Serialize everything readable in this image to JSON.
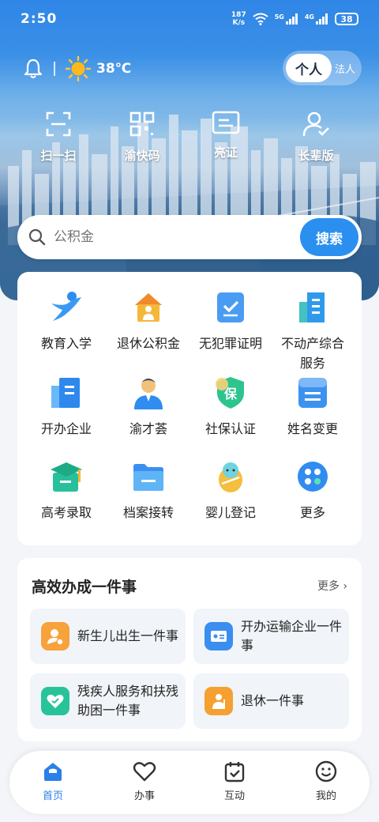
{
  "status_bar": {
    "time": "2:50",
    "net_speed_value": "187",
    "net_speed_unit": "K/s",
    "signal1": "5G",
    "signal2": "4G",
    "battery": "38"
  },
  "header": {
    "temperature": "38℃",
    "mode_toggle": {
      "active": "个人",
      "inactive": "法人"
    }
  },
  "quick_actions": [
    {
      "label": "扫一扫",
      "icon": "scan-icon"
    },
    {
      "label": "渝快码",
      "icon": "qrcode-icon"
    },
    {
      "label": "亮证",
      "icon": "id-card-icon"
    },
    {
      "label": "长辈版",
      "icon": "elder-user-icon"
    }
  ],
  "search": {
    "placeholder": "公积金",
    "button": "搜索"
  },
  "services": [
    {
      "label": "教育入学",
      "icon": "education-icon"
    },
    {
      "label": "退休公积金",
      "icon": "retirement-fund-icon"
    },
    {
      "label": "无犯罪证明",
      "icon": "no-crime-certificate-icon"
    },
    {
      "label": "不动产综合服务",
      "icon": "real-estate-icon"
    },
    {
      "label": "开办企业",
      "icon": "open-business-icon"
    },
    {
      "label": "渝才荟",
      "icon": "talent-icon"
    },
    {
      "label": "社保认证",
      "icon": "social-security-icon"
    },
    {
      "label": "姓名变更",
      "icon": "name-change-icon"
    },
    {
      "label": "高考录取",
      "icon": "exam-admission-icon"
    },
    {
      "label": "档案接转",
      "icon": "archive-transfer-icon"
    },
    {
      "label": "婴儿登记",
      "icon": "baby-registration-icon"
    },
    {
      "label": "更多",
      "icon": "more-apps-icon"
    }
  ],
  "one_thing": {
    "title": "高效办成一件事",
    "more": "更多",
    "items": [
      {
        "label": "新生儿出生一件事",
        "icon": "newborn-icon",
        "color": "#f7a23a"
      },
      {
        "label": "开办运输企业一件事",
        "icon": "transport-icon",
        "color": "#3a8ef0"
      },
      {
        "label": "残疾人服务和扶残助困一件事",
        "icon": "disability-care-icon",
        "color": "#29c39a"
      },
      {
        "label": "退休一件事",
        "icon": "retire-icon",
        "color": "#f5a030"
      }
    ]
  },
  "bottom_nav": [
    {
      "label": "首页",
      "active": true
    },
    {
      "label": "办事",
      "active": false
    },
    {
      "label": "互动",
      "active": false
    },
    {
      "label": "我的",
      "active": false
    }
  ],
  "colors": {
    "primary": "#2b8ff0",
    "nav_active": "#2b7fe8"
  }
}
